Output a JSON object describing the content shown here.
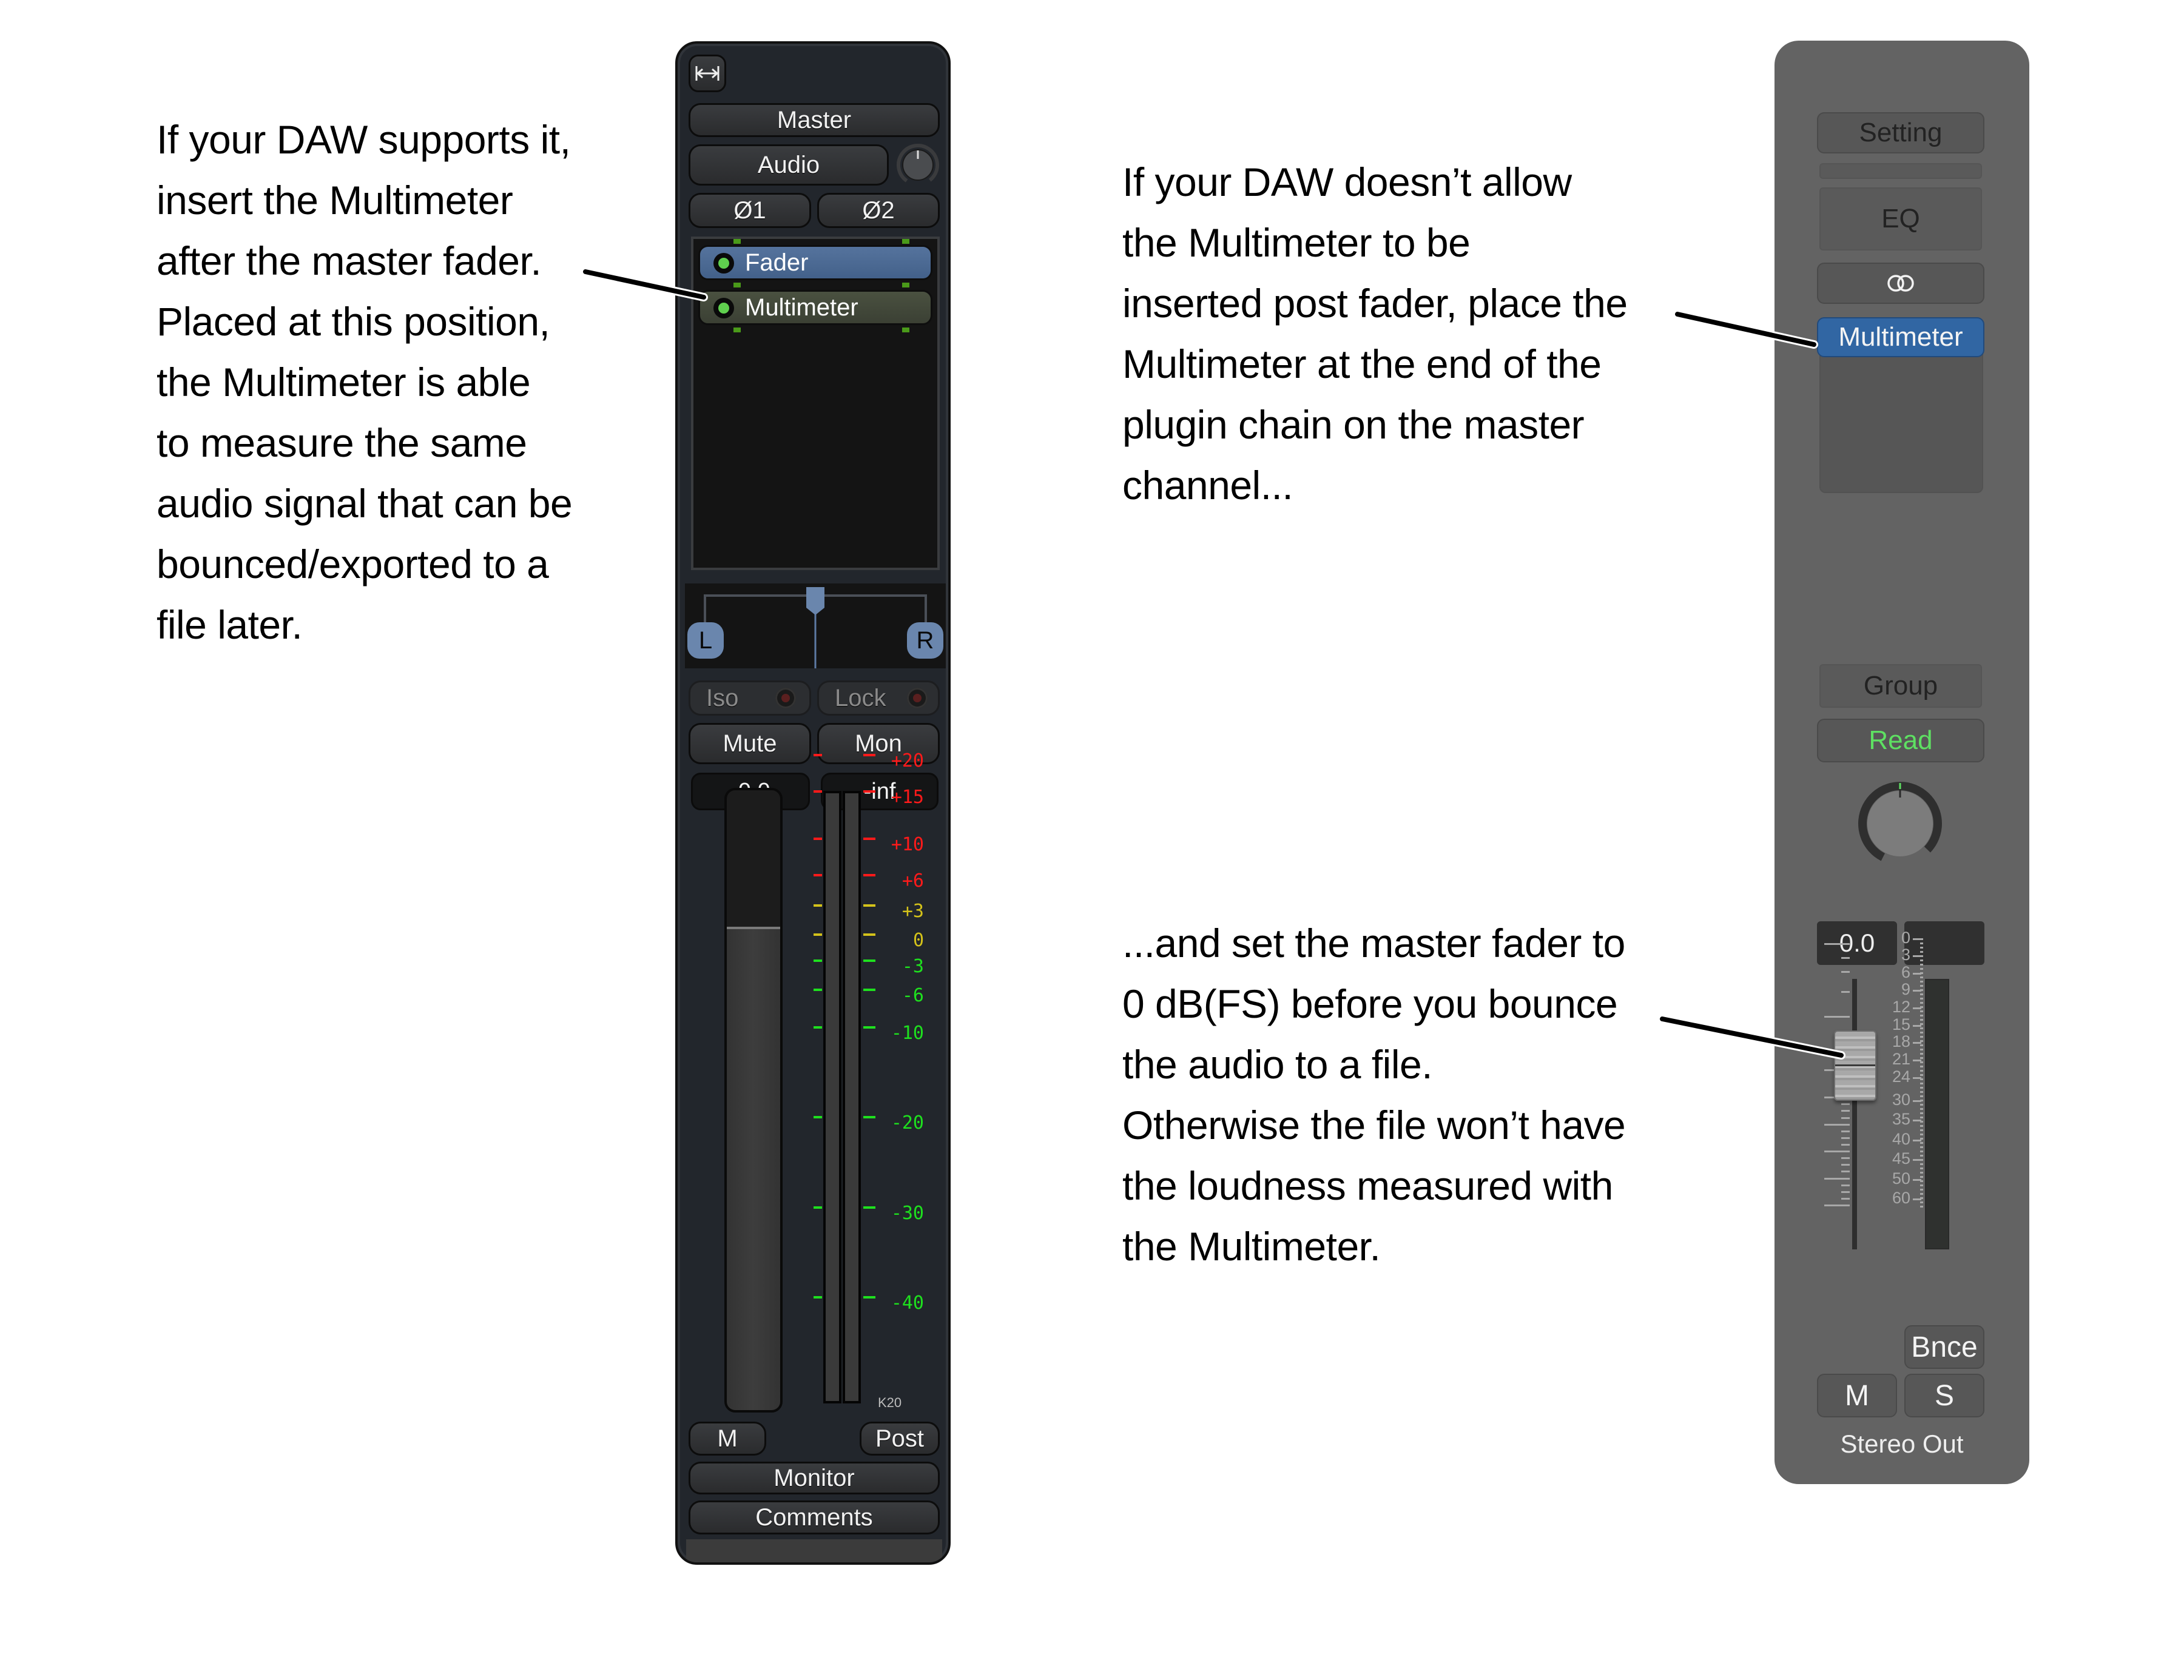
{
  "annotations": {
    "left": [
      "If your DAW supports it,",
      "insert the Multimeter",
      "after the master fader.",
      "Placed at this position,",
      "the Multimeter is able",
      "to measure the same",
      "audio signal that can be",
      "bounced/exported to a",
      "file later."
    ],
    "right_top": [
      "If your DAW doesn’t allow",
      "the Multimeter to be",
      "inserted post fader, place the",
      "Multimeter at the end of the",
      "plugin chain on the master",
      "channel..."
    ],
    "right_bottom": [
      "...and set the master fader to",
      "0 dB(FS) before you bounce",
      "the audio to a file.",
      "Otherwise the file won’t have",
      "the loudness measured with",
      "the Multimeter."
    ]
  },
  "left_strip": {
    "width_toggle_icon": "expand-width-icon",
    "name": "Master",
    "input": "Audio",
    "phase_buttons": [
      "Ø1",
      "Ø2"
    ],
    "plugins": [
      {
        "name": "Fader",
        "active": true,
        "color": "#4a6a96"
      },
      {
        "name": "Multimeter",
        "active": true,
        "color": "#434a3a"
      }
    ],
    "pan": {
      "left": "L",
      "right": "R"
    },
    "iso": "Iso",
    "lock": "Lock",
    "mute": "Mute",
    "mon": "Mon",
    "gain_readout": "-0.0",
    "peak_readout": "-inf",
    "fader_level": 0.78,
    "meter_scale": [
      {
        "label": "+20",
        "db": 20,
        "color": "#ff1a1a"
      },
      {
        "label": "+15",
        "db": 15,
        "color": "#ff1a1a"
      },
      {
        "label": "+10",
        "db": 10,
        "color": "#ff1a1a"
      },
      {
        "label": "+6",
        "db": 6,
        "color": "#ff1a1a"
      },
      {
        "label": "+3",
        "db": 3,
        "color": "#d4c21a"
      },
      {
        "label": "0",
        "db": 0,
        "color": "#d4c21a"
      },
      {
        "label": "-3",
        "db": -3,
        "color": "#1ee01e"
      },
      {
        "label": "-6",
        "db": -6,
        "color": "#1ee01e"
      },
      {
        "label": "-10",
        "db": -10,
        "color": "#1ee01e"
      },
      {
        "label": "-20",
        "db": -20,
        "color": "#1ee01e"
      },
      {
        "label": "-30",
        "db": -30,
        "color": "#1ee01e"
      },
      {
        "label": "-40",
        "db": -40,
        "color": "#1ee01e"
      }
    ],
    "meter_type": "K20",
    "meter_button": "M",
    "post_button": "Post",
    "monitor": "Monitor",
    "comments": "Comments"
  },
  "right_strip": {
    "setting": "Setting",
    "eq": "EQ",
    "link_icon": "stereo-link-icon",
    "plugin": "Multimeter",
    "plugin_color": "#3166a3",
    "group": "Group",
    "automation": "Read",
    "automation_color": "#5ee062",
    "volume_readout": "0.0",
    "peak_readout": "",
    "fader_db": 0,
    "meter_scale": [
      "0",
      "3",
      "6",
      "9",
      "12",
      "15",
      "18",
      "21",
      "24",
      "30",
      "35",
      "40",
      "45",
      "50",
      "60"
    ],
    "bounce": "Bnce",
    "mute": "M",
    "solo": "S",
    "name": "Stereo Out"
  }
}
